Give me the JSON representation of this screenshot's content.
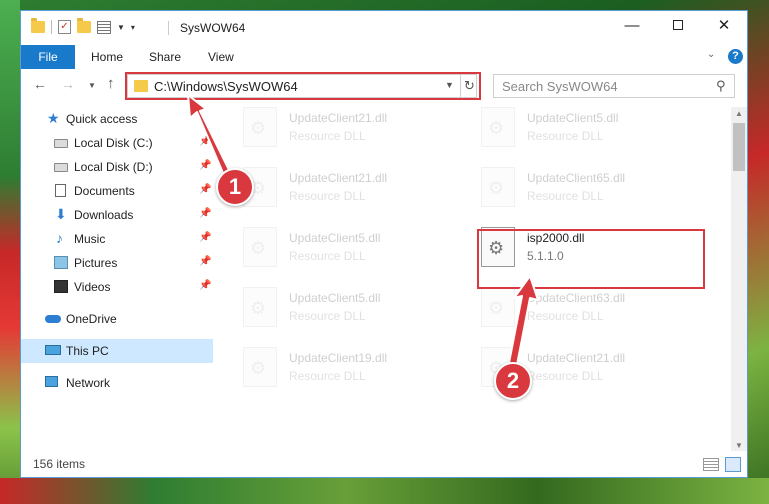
{
  "window": {
    "title": "SysWOW64"
  },
  "ribbon": {
    "tabs": {
      "file": "File",
      "home": "Home",
      "share": "Share",
      "view": "View"
    }
  },
  "address": {
    "path": "C:\\Windows\\SysWOW64"
  },
  "search": {
    "placeholder": "Search SysWOW64"
  },
  "sidebar": {
    "items": [
      {
        "label": "Quick access",
        "icon": "star-icon"
      },
      {
        "label": "Local Disk (C:)",
        "icon": "drive-icon",
        "pinned": true
      },
      {
        "label": "Local Disk (D:)",
        "icon": "drive-icon",
        "pinned": true
      },
      {
        "label": "Documents",
        "icon": "documents-icon",
        "pinned": true
      },
      {
        "label": "Downloads",
        "icon": "downloads-icon",
        "pinned": true
      },
      {
        "label": "Music",
        "icon": "music-icon",
        "pinned": true
      },
      {
        "label": "Pictures",
        "icon": "pictures-icon",
        "pinned": true
      },
      {
        "label": "Videos",
        "icon": "videos-icon",
        "pinned": true
      },
      {
        "label": "OneDrive",
        "icon": "onedrive-icon"
      },
      {
        "label": "This PC",
        "icon": "this-pc-icon",
        "selected": true
      },
      {
        "label": "Network",
        "icon": "network-icon"
      }
    ]
  },
  "files": [
    {
      "name": "UpdateClient21.dll",
      "type": "Resource DLL"
    },
    {
      "name": "UpdateClient5.dll",
      "type": "Resource DLL"
    },
    {
      "name": "UpdateClient21.dll",
      "type": "Resource DLL"
    },
    {
      "name": "UpdateClient65.dll",
      "type": "Resource DLL"
    },
    {
      "name": "UpdateClient5.dll",
      "type": "Resource DLL"
    },
    {
      "name": "isp2000.dll",
      "type": "5.1.1.0"
    },
    {
      "name": "UpdateClient5.dll",
      "type": "Resource DLL"
    },
    {
      "name": "UpdateClient63.dll",
      "type": "Resource DLL"
    },
    {
      "name": "UpdateClient19.dll",
      "type": "Resource DLL"
    },
    {
      "name": "UpdateClient21.dll",
      "type": "Resource DLL"
    }
  ],
  "status": {
    "item_count": "156 items"
  },
  "annotations": {
    "step1": "1",
    "step2": "2"
  },
  "colors": {
    "accent": "#1979ca",
    "highlight": "#d9383e",
    "selection": "#cde8ff"
  }
}
